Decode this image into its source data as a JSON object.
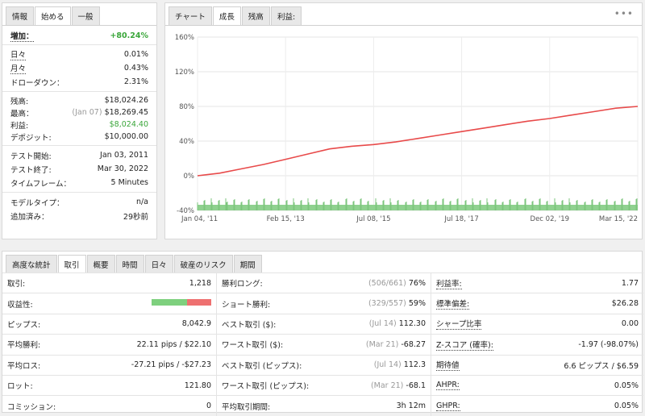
{
  "left_tabs": [
    "情報",
    "始める",
    "一般"
  ],
  "summary": {
    "gain": {
      "label": "増加：",
      "value": "+80.24%"
    },
    "daily": {
      "label": "日々",
      "value": "0.01%"
    },
    "monthly": {
      "label": "月々",
      "value": "0.43%"
    },
    "drawdown": {
      "label": "ドローダウン：",
      "value": "2.31%"
    },
    "balance": {
      "label": "残高:",
      "value": "$18,024.26"
    },
    "highest": {
      "label": "最高：",
      "date": "(Jan 07)",
      "value": "$18,269.45"
    },
    "profit": {
      "label": "利益:",
      "value": "$8,024.40"
    },
    "deposit": {
      "label": "デポジット:",
      "value": "$10,000.00"
    },
    "test_start": {
      "label": "テスト開始:",
      "value": "Jan 03, 2011"
    },
    "test_end": {
      "label": "テスト終了:",
      "value": "Mar 30, 2022"
    },
    "timeframe": {
      "label": "タイムフレーム：",
      "value": "5 Minutes"
    },
    "model_type": {
      "label": "モデルタイプ：",
      "value": "n/a"
    },
    "added": {
      "label": "追加済み：",
      "value": "29秒前"
    }
  },
  "chart_tabs": [
    "チャート",
    "成長",
    "残高",
    "利益:"
  ],
  "chart_menu": "•••",
  "chart_data": {
    "type": "line",
    "y_ticks": [
      "160%",
      "120%",
      "80%",
      "40%",
      "0%",
      "-40%"
    ],
    "y_values": [
      160,
      120,
      80,
      40,
      0,
      -40
    ],
    "x_ticks": [
      "Jan 04, '11",
      "Feb 15, '13",
      "Jul 08, '15",
      "Jul 18, '17",
      "Dec 02, '19",
      "Mar 15, '22"
    ],
    "ylim": [
      -40,
      160
    ],
    "series": [
      {
        "color": "#e84a4a",
        "x": [
          0,
          0.05,
          0.1,
          0.15,
          0.2,
          0.25,
          0.3,
          0.35,
          0.4,
          0.45,
          0.5,
          0.55,
          0.6,
          0.65,
          0.7,
          0.75,
          0.8,
          0.85,
          0.9,
          0.95,
          1.0
        ],
        "y": [
          0,
          3,
          8,
          13,
          19,
          25,
          31,
          34,
          36,
          39,
          43,
          47,
          51,
          55,
          59,
          63,
          66,
          70,
          74,
          78,
          80
        ]
      }
    ],
    "bars_color": "#8fd18f"
  },
  "stat_tabs": [
    "高度な統計",
    "取引",
    "概要",
    "時間",
    "日々",
    "破産のリスク",
    "期間"
  ],
  "stats": [
    {
      "c1": {
        "label": "取引:",
        "value": "1,218"
      },
      "c2": {
        "label": "勝利ロング:",
        "sub": "(506/661)",
        "value": "76%"
      },
      "c3": {
        "label": "利益率:",
        "value": "1.77"
      }
    },
    {
      "c1": {
        "label": "収益性:",
        "value": ""
      },
      "c2": {
        "label": "ショート勝利:",
        "sub": "(329/557)",
        "value": "59%"
      },
      "c3": {
        "label": "標準偏差:",
        "value": "$26.28"
      }
    },
    {
      "c1": {
        "label": "ピップス:",
        "value": "8,042.9"
      },
      "c2": {
        "label": "ベスト取引 ($):",
        "sub": "(Jul 14)",
        "value": "112.30"
      },
      "c3": {
        "label": "シャープ比率",
        "value": "0.00"
      }
    },
    {
      "c1": {
        "label": "平均勝利:",
        "value": "22.11 pips / $22.10"
      },
      "c2": {
        "label": "ワースト取引 ($):",
        "sub": "(Mar 21)",
        "value": "-68.27"
      },
      "c3": {
        "label": "Z-スコア (確率):",
        "value": "-1.97 (-98.07%)"
      }
    },
    {
      "c1": {
        "label": "平均ロス:",
        "value": "-27.21 pips / -$27.23"
      },
      "c2": {
        "label": "ベスト取引 (ピップス):",
        "sub": "(Jul 14)",
        "value": "112.3"
      },
      "c3": {
        "label": "期待値",
        "value": "6.6 ピップス / $6.59"
      }
    },
    {
      "c1": {
        "label": "ロット:",
        "value": "121.80"
      },
      "c2": {
        "label": "ワースト取引 (ピップス):",
        "sub": "(Mar 21)",
        "value": "-68.1"
      },
      "c3": {
        "label": "AHPR:",
        "value": "0.05%"
      }
    },
    {
      "c1": {
        "label": "コミッション:",
        "value": "0"
      },
      "c2": {
        "label": "平均取引期間:",
        "sub": "",
        "value": "3h 12m"
      },
      "c3": {
        "label": "GHPR:",
        "value": "0.05%"
      }
    }
  ],
  "profitability": {
    "win": 0.59,
    "win_color": "#7ed07e",
    "loss_color": "#ee7070"
  }
}
